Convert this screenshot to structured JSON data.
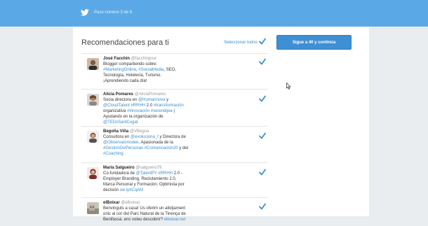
{
  "header": {
    "step_text": "Paso número 3 de 6"
  },
  "main": {
    "heading": "Recomendaciones para ti",
    "select_all_label": "Seleccionar todos",
    "follow_button_label": "Sigue a 40 y continúa"
  },
  "colors": {
    "topbar": "#5aa9e6",
    "accent": "#3b8fd0",
    "check": "#3b8fd0"
  },
  "recommendations": [
    {
      "name": "José Facchin",
      "handle": "@facchinjose",
      "lines": [
        [
          {
            "t": "Blogger compartiendo sobre:"
          }
        ],
        [
          {
            "t": "#MarketingOnline",
            "l": true
          },
          {
            "t": ", "
          },
          {
            "t": "#SocialMedia",
            "l": true
          },
          {
            "t": ", SEO,"
          }
        ],
        [
          {
            "t": "Tecnología, Hotelería, Turismo."
          }
        ],
        [
          {
            "t": "¡Aprendiendo cada día!"
          }
        ]
      ]
    },
    {
      "name": "Alicia Pomares",
      "handle": "@AliciaPomares",
      "lines": [
        [
          {
            "t": "Socia directora en "
          },
          {
            "t": "@Humannova",
            "l": true
          },
          {
            "t": " y"
          }
        ],
        [
          {
            "t": "@CloudTalent",
            "l": true
          },
          {
            "t": " "
          },
          {
            "t": "#RRHH",
            "l": true
          },
          {
            "t": " 2.0 "
          },
          {
            "t": "#transformación",
            "l": true
          }
        ],
        [
          {
            "t": "organizativa "
          },
          {
            "t": "#innovación",
            "l": true
          },
          {
            "t": " "
          },
          {
            "t": "#serendipia",
            "l": true
          },
          {
            "t": " |"
          }
        ],
        [
          {
            "t": "Ayudando en la organización de"
          }
        ],
        [
          {
            "t": "@TEDxSantCugat",
            "l": true
          }
        ]
      ]
    },
    {
      "name": "Begoña Viña",
      "handle": "@VBegoa",
      "lines": [
        [
          {
            "t": "Consultora en "
          },
          {
            "t": "@evoluciona_t",
            "l": true
          },
          {
            "t": " y Directora de"
          }
        ],
        [
          {
            "t": "@Observatoriodee",
            "l": true
          },
          {
            "t": ". Apasionada de la"
          }
        ],
        [
          {
            "t": "#GestiónDePersonas",
            "l": true
          },
          {
            "t": " "
          },
          {
            "t": "#Comunicación20",
            "l": true
          },
          {
            "t": " y del"
          }
        ],
        [
          {
            "t": "#Coaching",
            "l": true
          }
        ]
      ]
    },
    {
      "name": "María Salgueiro",
      "handle": "@salgueiro79",
      "lines": [
        [
          {
            "t": "Co-fundadora de "
          },
          {
            "t": "@TalentPY",
            "l": true
          },
          {
            "t": " "
          },
          {
            "t": "#RRHH",
            "l": true
          },
          {
            "t": " 2.0 -"
          }
        ],
        [
          {
            "t": "Employer Branding, Reclutamiento 2.0,"
          }
        ],
        [
          {
            "t": "Marca Personal y Formación. Optimista por"
          }
        ],
        [
          {
            "t": "decisión "
          },
          {
            "t": "ow.ly/tCqAM",
            "l": true
          }
        ]
      ]
    },
    {
      "name": "elBoixar",
      "handle": "@elboixar",
      "lines": [
        [
          {
            "t": "Benvinguts a casa! Us oferim un allotjament"
          }
        ],
        [
          {
            "t": "únic al cor del Parc Natural de la Tinença de"
          }
        ],
        [
          {
            "t": "Benifassà. ens voleu descobrir? "
          },
          {
            "t": "elboixar.net",
            "l": true
          }
        ]
      ]
    }
  ]
}
